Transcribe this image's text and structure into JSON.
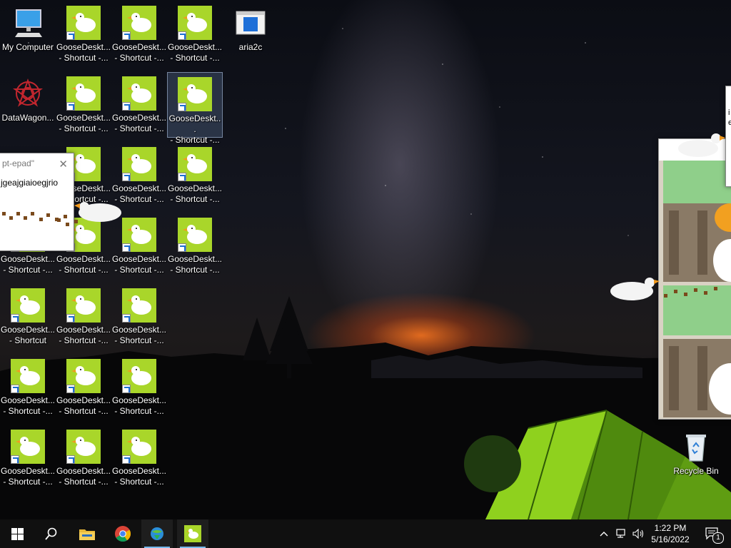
{
  "desktop": {
    "icons": [
      {
        "label": "My Computer",
        "kind": "computer-icon"
      },
      {
        "label": "GooseDeskt...\n- Shortcut -...",
        "kind": "goose-icon"
      },
      {
        "label": "GooseDeskt...\n- Shortcut -...",
        "kind": "goose-icon"
      },
      {
        "label": "GooseDeskt...\n- Shortcut -...",
        "kind": "goose-icon"
      },
      {
        "label": "aria2c",
        "kind": "aria2c-icon"
      },
      {
        "label": "DataWagon...",
        "kind": "datawagon-icon"
      },
      {
        "label": "GooseDeskt...\n- Shortcut -...",
        "kind": "goose-icon"
      },
      {
        "label": "GooseDeskt...\n- Shortcut -...",
        "kind": "goose-icon"
      },
      {
        "label": "GooseDeskt...\n- Shortcut -...",
        "kind": "goose-icon"
      },
      {
        "label": "GooseDeskt...\n- Shortcut -...",
        "kind": "goose-icon"
      },
      {
        "label": "GooseDeskt...\n- Shortcut -...",
        "kind": "goose-icon"
      },
      {
        "label": "GooseDeskt...\n- Shortcut -...",
        "kind": "goose-icon"
      },
      {
        "label": "GooseDeskt...\n- Shortcut -...",
        "kind": "goose-icon"
      },
      {
        "label": "GooseDeskt...\n- Shortcut -...",
        "kind": "goose-icon"
      },
      {
        "label": "GooseDeskt...\n- Shortcut -...",
        "kind": "goose-icon"
      },
      {
        "label": "GooseDeskt...\n- Shortcut -...",
        "kind": "goose-icon"
      },
      {
        "label": "GooseDeskt...\n- Shortcut",
        "kind": "goose-icon"
      },
      {
        "label": "GooseDeskt...\n- Shortcut -...",
        "kind": "goose-icon"
      },
      {
        "label": "GooseDeskt...\n- Shortcut -...",
        "kind": "goose-icon"
      },
      {
        "label": "GooseDeskt...\n- Shortcut -...",
        "kind": "goose-icon"
      },
      {
        "label": "GooseDeskt...\n- Shortcut -...",
        "kind": "goose-icon"
      },
      {
        "label": "GooseDeskt...\n- Shortcut -...",
        "kind": "goose-icon"
      },
      {
        "label": "GooseDeskt...\n- Shortcut -...",
        "kind": "goose-icon"
      },
      {
        "label": "GooseDeskt...\n- Shortcut -...",
        "kind": "goose-icon"
      },
      {
        "label": "GooseDeskt...\n- Shortcut -...",
        "kind": "goose-icon"
      },
      {
        "label": "Recycle Bin",
        "kind": "recycle-bin-icon"
      }
    ]
  },
  "notepad": {
    "title": "pt-epad\"",
    "text": "jgeajgiaioegjrio"
  },
  "side_window": {
    "text": "i\ne"
  },
  "taskbar": {
    "buttons": [
      {
        "name": "start-button",
        "icon": "windows-logo-icon"
      },
      {
        "name": "search-button",
        "icon": "search-icon"
      },
      {
        "name": "file-explorer-button",
        "icon": "folder-icon"
      },
      {
        "name": "chrome-button",
        "icon": "chrome-icon"
      },
      {
        "name": "download-manager-button",
        "icon": "globe-download-icon"
      },
      {
        "name": "goose-desktop-button",
        "icon": "goose-icon"
      }
    ],
    "clock": {
      "time": "1:22 PM",
      "date": "5/16/2022"
    },
    "notifications_count": "1"
  },
  "colors": {
    "goose_green": "#a9d62a",
    "taskbar": "#101010",
    "accent": "#76b9ed"
  }
}
